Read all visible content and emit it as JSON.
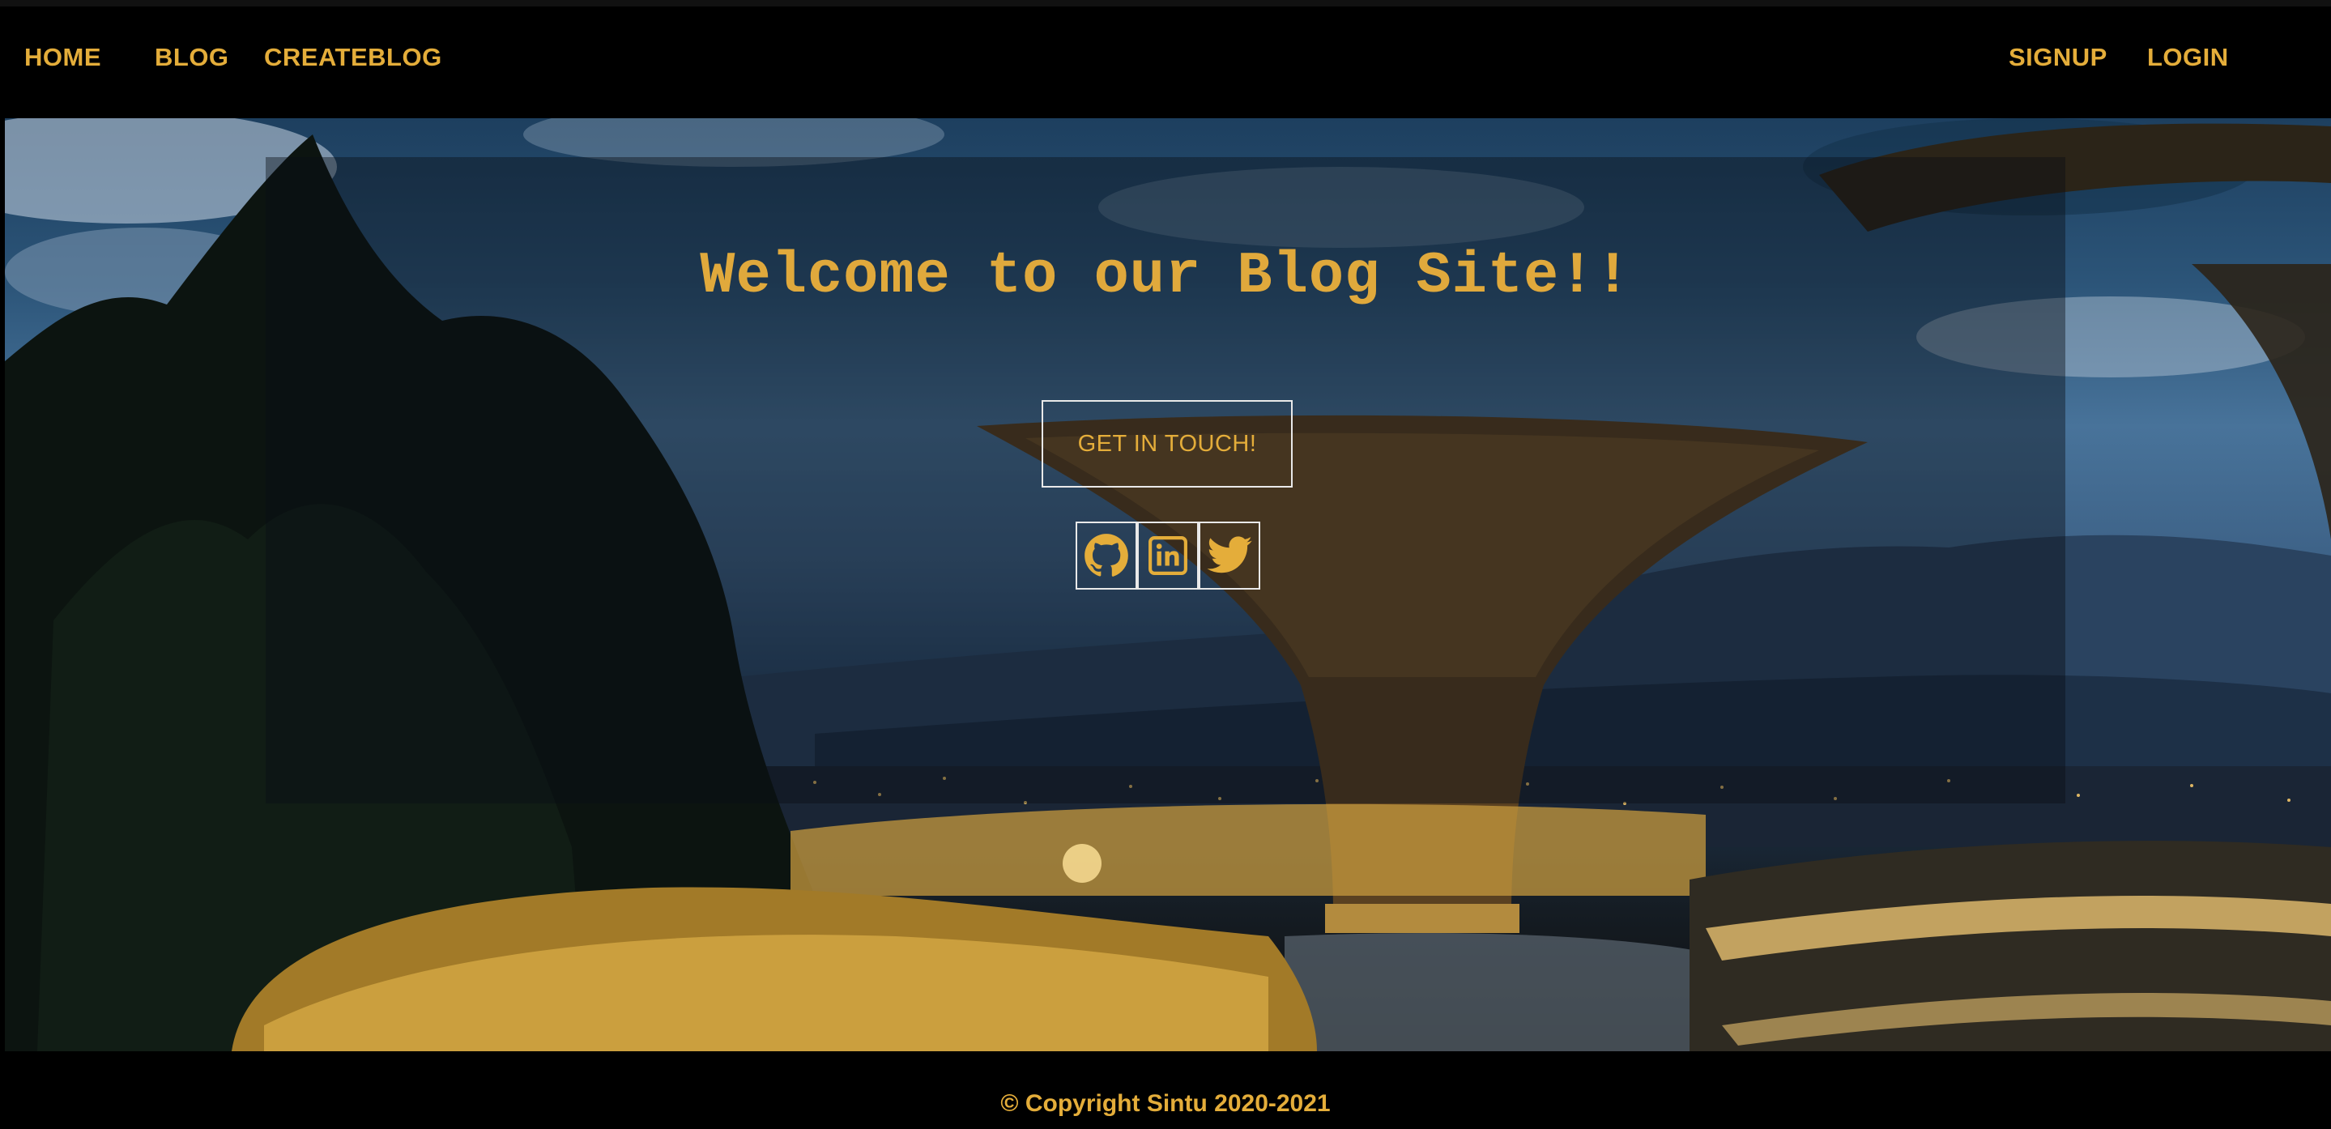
{
  "navbar": {
    "left_links": [
      {
        "label": "HOME"
      },
      {
        "label": "BLOG"
      },
      {
        "label": "CREATEBLOG"
      }
    ],
    "right_links": [
      {
        "label": "SIGNUP"
      },
      {
        "label": "LOGIN"
      }
    ]
  },
  "hero": {
    "title": "Welcome to our Blog Site!!",
    "cta_label": "GET IN TOUCH!",
    "social_icons": [
      "github-icon",
      "linkedin-icon",
      "twitter-icon"
    ]
  },
  "footer": {
    "copyright": "© Copyright Sintu 2020-2021"
  },
  "colors": {
    "accent": "#e4ad3a",
    "navbar_bg": "#000000",
    "footer_bg": "#000000",
    "button_border": "#e9e9e9"
  }
}
